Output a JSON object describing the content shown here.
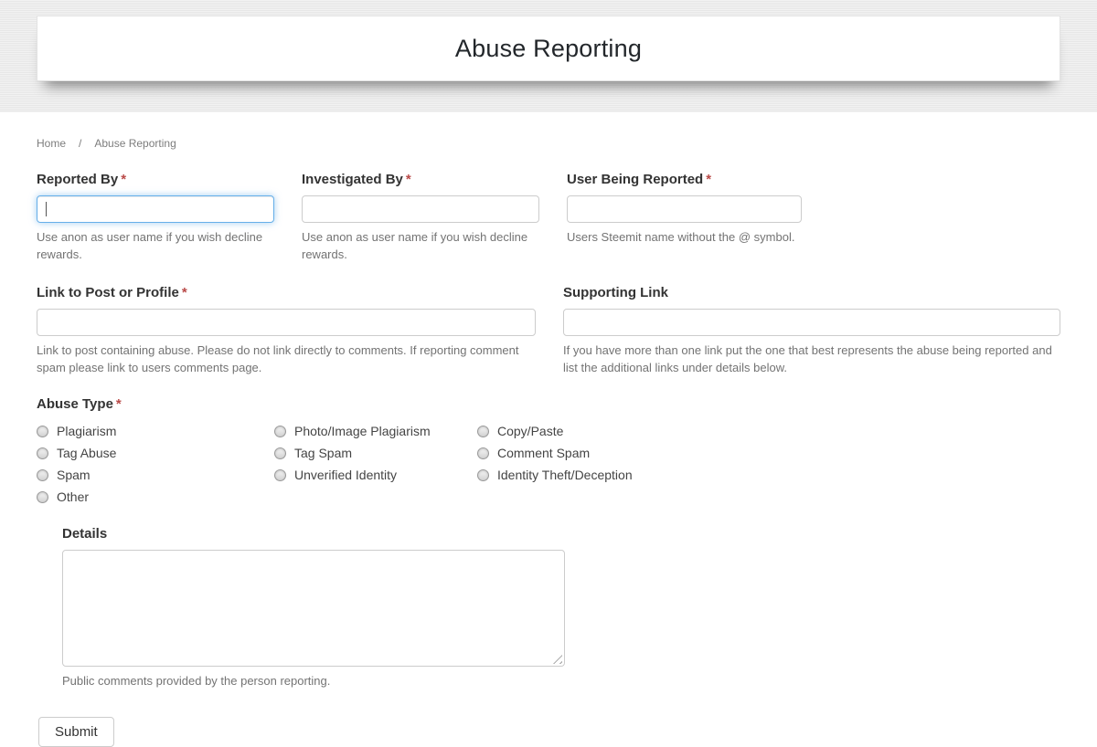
{
  "header": {
    "title": "Abuse Reporting"
  },
  "breadcrumb": {
    "home": "Home",
    "separator": "/",
    "current": "Abuse Reporting"
  },
  "colors": {
    "header_band": "#ebebeb",
    "focus_border": "#66afe9",
    "required_red": "#b94a48",
    "label_text": "#333333",
    "help_text": "#737373"
  },
  "form": {
    "reported_by": {
      "label": "Reported By",
      "required": "*",
      "value": "",
      "help": "Use anon as user name if you wish decline rewards."
    },
    "investigated_by": {
      "label": "Investigated By",
      "required": "*",
      "value": "",
      "help": "Use anon as user name if you wish decline rewards."
    },
    "user_being_reported": {
      "label": "User Being Reported",
      "required": "*",
      "value": "",
      "help": "Users Steemit name without the @ symbol."
    },
    "link_to_post": {
      "label": "Link to Post or Profile",
      "required": "*",
      "value": "",
      "help": "Link to post containing abuse. Please do not link directly to comments. If reporting comment spam please link to users comments page."
    },
    "supporting_link": {
      "label": "Supporting Link",
      "value": "",
      "help": "If you have more than one link put the one that best represents the abuse being reported and list the additional links under details below."
    },
    "abuse_type": {
      "label": "Abuse Type",
      "required": "*",
      "options": [
        {
          "label": "Plagiarism",
          "checked": false
        },
        {
          "label": "Tag Abuse",
          "checked": false
        },
        {
          "label": "Spam",
          "checked": false
        },
        {
          "label": "Other",
          "checked": false
        },
        {
          "label": "Photo/Image Plagiarism",
          "checked": false
        },
        {
          "label": "Tag Spam",
          "checked": false
        },
        {
          "label": "Unverified Identity",
          "checked": false
        },
        {
          "label": "Copy/Paste",
          "checked": false
        },
        {
          "label": "Comment Spam",
          "checked": false
        },
        {
          "label": "Identity Theft/Deception",
          "checked": false
        }
      ]
    },
    "details": {
      "label": "Details",
      "value": "",
      "help": "Public comments provided by the person reporting."
    },
    "submit_label": "Submit"
  }
}
